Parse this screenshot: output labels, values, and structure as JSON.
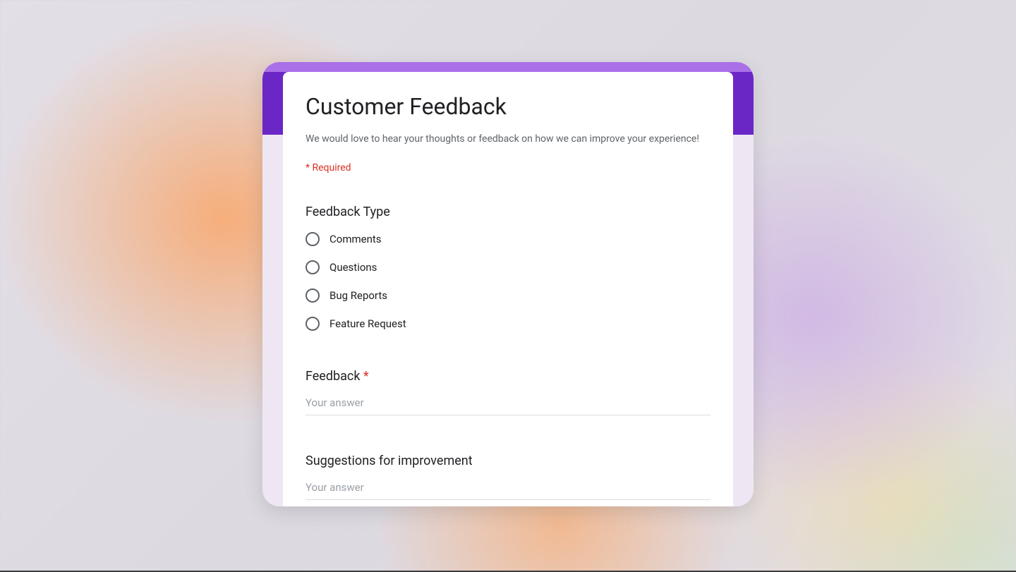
{
  "form": {
    "title": "Customer Feedback",
    "description": "We would love to hear your thoughts or feedback on how we can improve your experience!",
    "required_note": "* Required"
  },
  "questions": {
    "feedback_type": {
      "title": "Feedback Type",
      "options": [
        "Comments",
        "Questions",
        "Bug Reports",
        "Feature Request"
      ]
    },
    "feedback": {
      "title": "Feedback ",
      "required": true,
      "placeholder": "Your answer"
    },
    "suggestions": {
      "title": "Suggestions for improvement",
      "placeholder": "Your answer"
    }
  },
  "colors": {
    "accent_light": "#a970e8",
    "accent_dark": "#6b26c6",
    "form_bg": "#eee7f3",
    "required": "#d93025"
  }
}
